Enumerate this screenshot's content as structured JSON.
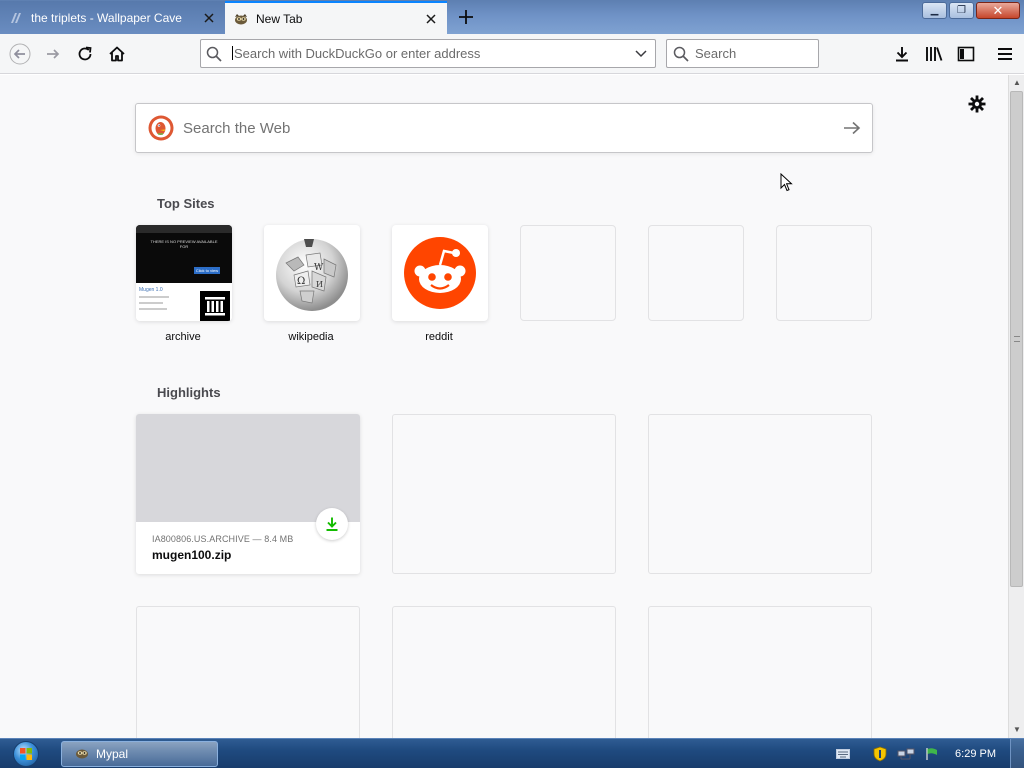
{
  "tabs": [
    {
      "title": "the triplets - Wallpaper Cave",
      "active": false
    },
    {
      "title": "New Tab",
      "active": true
    }
  ],
  "window_controls": {
    "minimize": "▁",
    "restore": "❐",
    "close": "✕"
  },
  "navbar": {
    "url_placeholder": "Search with DuckDuckGo or enter address",
    "search_placeholder": "Search"
  },
  "newtab": {
    "web_search_placeholder": "Search the Web",
    "top_sites_title": "Top Sites",
    "top_sites": [
      {
        "label": "archive"
      },
      {
        "label": "wikipedia"
      },
      {
        "label": "reddit"
      },
      {
        "label": ""
      },
      {
        "label": ""
      },
      {
        "label": ""
      }
    ],
    "archive_thumb_text": "THERE IS NO PREVIEW AVAILABLE FOR",
    "archive_thumb_button": "Click to view",
    "archive_thumb_item": "Mugen 1.0",
    "highlights_title": "Highlights",
    "highlights": [
      {
        "meta": "IA800806.US.ARCHIVE — 8.4 MB",
        "name": "mugen100.zip"
      }
    ]
  },
  "taskbar": {
    "task_label": "Mypal",
    "clock": "6:29 PM"
  },
  "colors": {
    "accent": "#0a84ff",
    "reddit": "#ff4500",
    "ddg": "#de5833",
    "download_green": "#12bc00"
  }
}
